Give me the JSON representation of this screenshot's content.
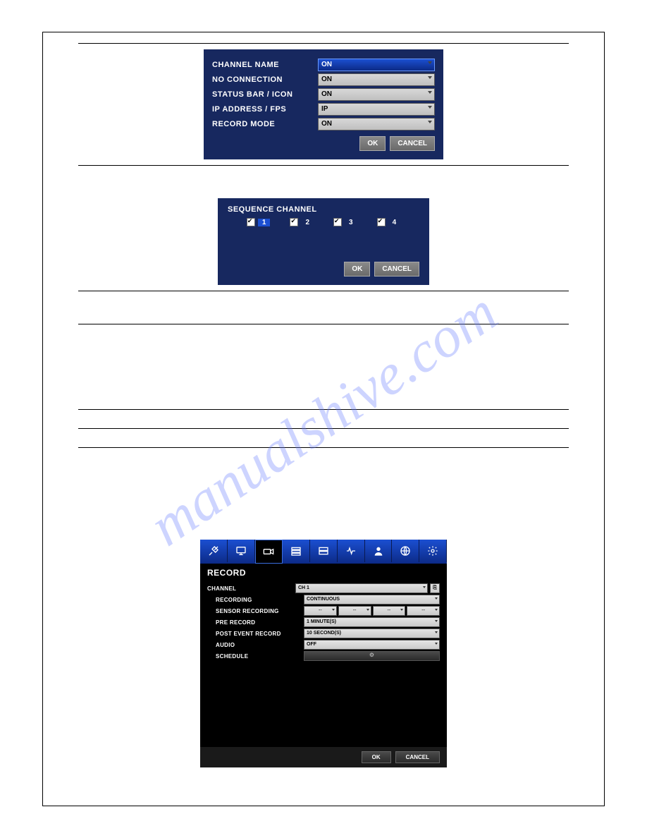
{
  "watermark": "manualshive.com",
  "osd": {
    "rows": [
      {
        "label": "CHANNEL NAME",
        "value": "ON"
      },
      {
        "label": "NO CONNECTION",
        "value": "ON"
      },
      {
        "label": "STATUS BAR / ICON",
        "value": "ON"
      },
      {
        "label": "IP ADDRESS / FPS",
        "value": "IP"
      },
      {
        "label": "RECORD MODE",
        "value": "ON"
      }
    ],
    "ok": "OK",
    "cancel": "CANCEL"
  },
  "sequence": {
    "title": "SEQUENCE CHANNEL",
    "channels": [
      {
        "num": "1",
        "checked": true,
        "hl": true
      },
      {
        "num": "2",
        "checked": true,
        "hl": false
      },
      {
        "num": "3",
        "checked": true,
        "hl": false
      },
      {
        "num": "4",
        "checked": true,
        "hl": false
      }
    ],
    "ok": "OK",
    "cancel": "CANCEL"
  },
  "record": {
    "title": "RECORD",
    "channel_label": "CHANNEL",
    "channel_value": "CH 1",
    "recording_label": "RECORDING",
    "recording_value": "CONTINUOUS",
    "sensor_label": "SENSOR RECORDING",
    "sensor_values": [
      "--",
      "--",
      "--",
      "--"
    ],
    "pre_label": "PRE RECORD",
    "pre_value": "1 MINUTE(S)",
    "post_label": "POST EVENT RECORD",
    "post_value": "10 SECOND(S)",
    "audio_label": "AUDIO",
    "audio_value": "OFF",
    "schedule_label": "SCHEDULE",
    "ok": "OK",
    "cancel": "CANCEL"
  }
}
